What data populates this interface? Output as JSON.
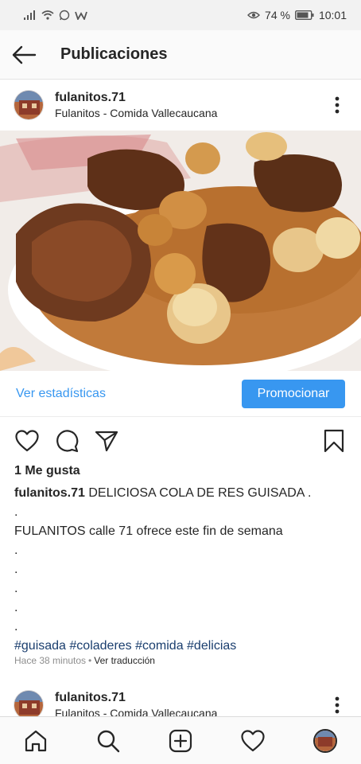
{
  "status_bar": {
    "battery": "74 %",
    "time": "10:01"
  },
  "app_bar": {
    "title": "Publicaciones",
    "back_icon": "arrow-left-icon"
  },
  "post": {
    "username": "fulanitos.71",
    "location": "Fulanitos - Comida Vallecaucana",
    "image_alt": "cola de res guisada",
    "stats_link": "Ver estadísticas",
    "promote_button": "Promocionar",
    "likes": "1 Me gusta",
    "caption_user": "fulanitos.71",
    "caption_text": "DELICIOSA COLA DE RES GUISADA .",
    "caption_lines": [
      ".",
      "FULANITOS calle 71 ofrece este fin de semana",
      ".",
      ".",
      ".",
      ".",
      "."
    ],
    "hashtags": "#guisada #coladeres #comida #delicias",
    "time_ago": "Hace 38 minutos",
    "separator": "•",
    "translate": "Ver traducción"
  },
  "next_post": {
    "username": "fulanitos.71",
    "location": "Fulanitos - Comida Vallecaucana"
  },
  "bottom_nav": [
    "home-icon",
    "search-icon",
    "add-post-icon",
    "activity-heart-icon",
    "profile-avatar"
  ],
  "colors": {
    "accent": "#3897f0",
    "hashtag": "#1a3e6e",
    "text": "#262626",
    "muted": "#8e8e8e"
  }
}
